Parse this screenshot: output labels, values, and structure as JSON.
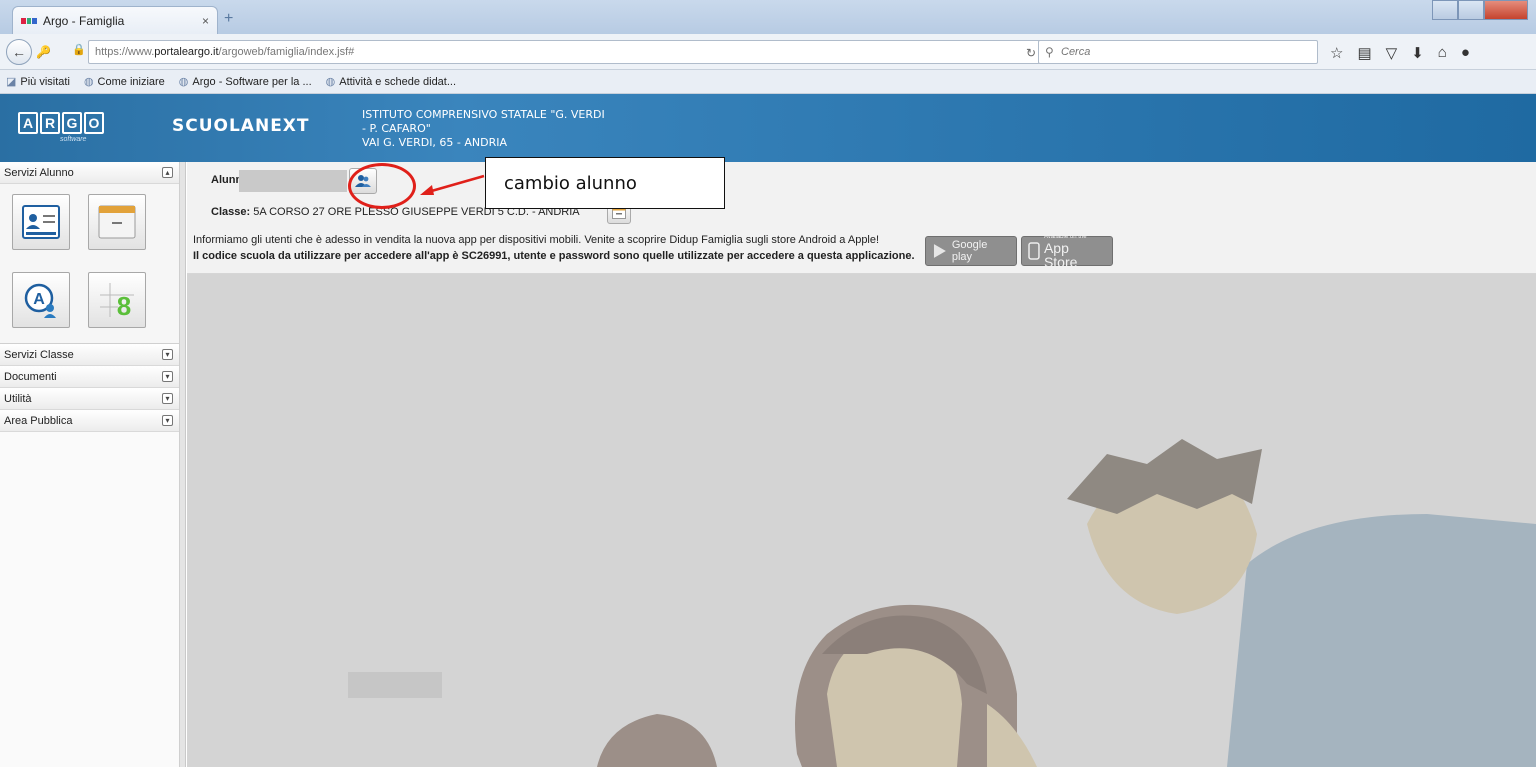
{
  "browser": {
    "tab_title": "Argo - Famiglia",
    "tab_close": "×",
    "new_tab": "+",
    "url_prefix": "https://www.",
    "url_domain": "portaleargo.it",
    "url_path": "/argoweb/famiglia/index.jsf#",
    "search_placeholder": "Cerca",
    "bookmarks": [
      "Più visitati",
      "Come iniziare",
      "Argo - Software per la ...",
      "Attività e schede didat..."
    ]
  },
  "header": {
    "logo_letters": [
      "A",
      "R",
      "G",
      "O"
    ],
    "logo_sub": "software",
    "product_name": "SCUOLANEXT",
    "school_line1": "ISTITUTO COMPRENSIVO STATALE \"G. VERDI",
    "school_line2": "- P. CAFARO\"",
    "school_line3": "VAI G. VERDI, 65 - ANDRIA"
  },
  "sidebar": {
    "sections": [
      {
        "label": "Servizi Alunno",
        "toggle": "▴"
      },
      {
        "label": "Servizi Classe",
        "toggle": "▾"
      },
      {
        "label": "Documenti",
        "toggle": "▾"
      },
      {
        "label": "Utilità",
        "toggle": "▾"
      },
      {
        "label": "Area Pubblica",
        "toggle": "▾"
      }
    ]
  },
  "main": {
    "alunno_label": "Alunn",
    "classe_label": "Classe:",
    "classe_value": "5A CORSO 27 ORE PLESSO GIUSEPPE VERDI 5 C.D. - ANDRIA",
    "notice_line1": "Informiamo gli utenti che è adesso in vendita la nuova app per dispositivi mobili. Venite a scoprire Didup Famiglia sugli store Android a Apple!",
    "notice_line2": "Il codice scuola da utilizzare per accedere all'app è SC26991, utente e password sono quelle utilizzate per accedere a questa applicazione.",
    "google_play_label": "Google play",
    "app_store_small": "Available on the",
    "app_store_label": "App Store"
  },
  "annotation": {
    "text": "cambio alunno",
    "color": "#e0201a"
  },
  "colors": {
    "header_blue": "#2e79b1",
    "icon_blue": "#1f5fa0",
    "icon_green": "#5bbf3a"
  }
}
